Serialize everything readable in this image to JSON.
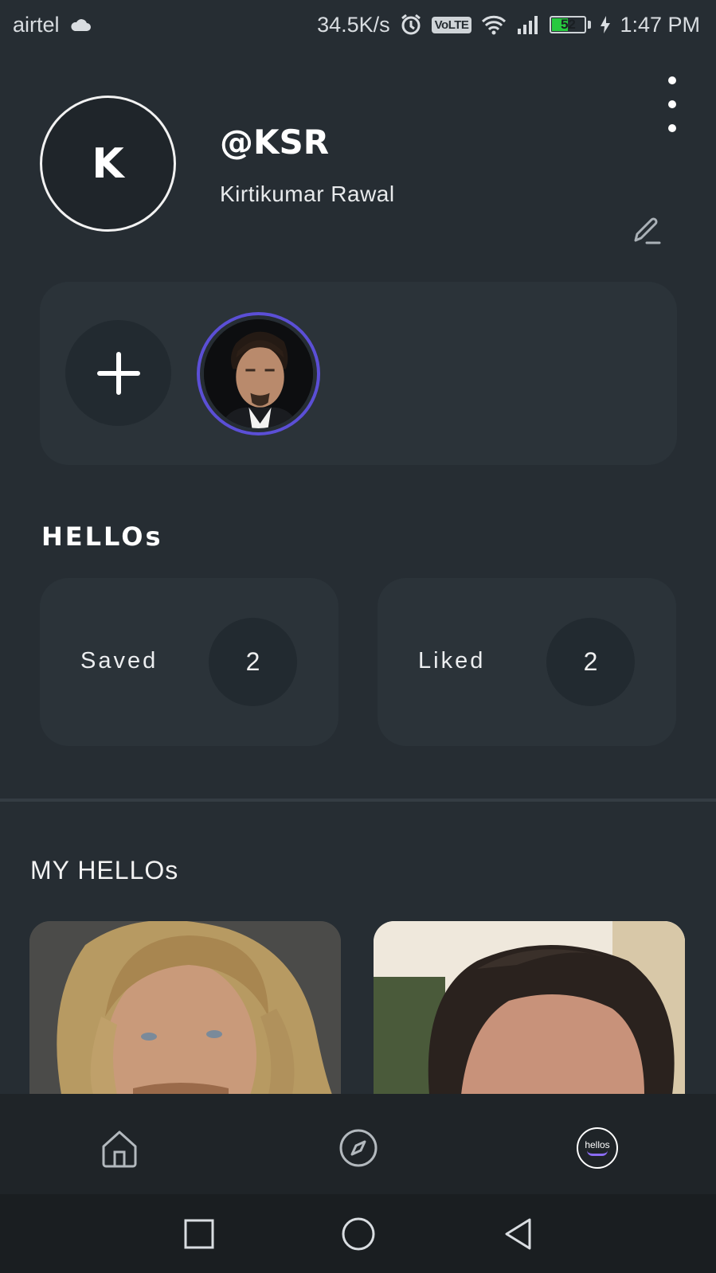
{
  "status_bar": {
    "carrier": "airtel",
    "speed": "34.5K/s",
    "volte": "VoLTE",
    "battery": "52",
    "time": "1:47 PM"
  },
  "profile": {
    "initial": "K",
    "handle": "@KSR",
    "name": "Kirtikumar Rawal"
  },
  "hellos_section": {
    "title": "HELLOs",
    "saved_label": "Saved",
    "saved_count": "2",
    "liked_label": "Liked",
    "liked_count": "2"
  },
  "my_hellos": {
    "title": "MY HELLOs"
  },
  "bottom_nav": {
    "profile_badge": "hellos"
  },
  "colors": {
    "background": "#262d33",
    "card": "#2b3339",
    "accent_ring": "#5b4fd6",
    "battery_green": "#27c93f"
  }
}
